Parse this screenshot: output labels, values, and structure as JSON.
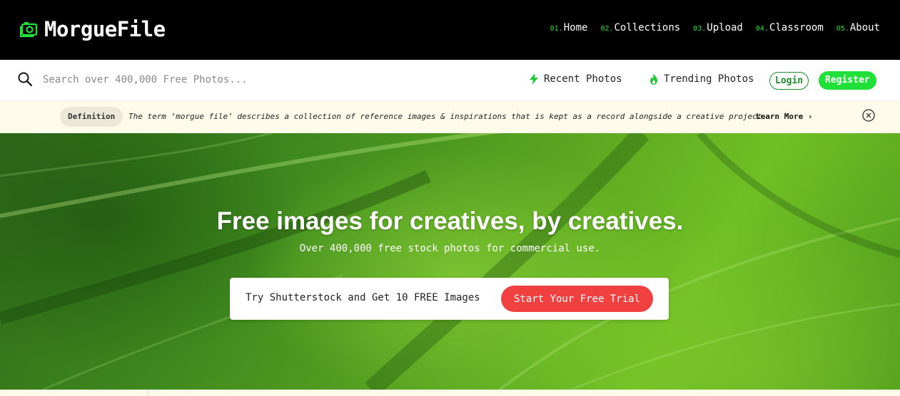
{
  "header": {
    "logo_text": "MorgueFile",
    "nav": [
      {
        "num": "01.",
        "label": "Home"
      },
      {
        "num": "02.",
        "label": "Collections"
      },
      {
        "num": "03.",
        "label": "Upload"
      },
      {
        "num": "04.",
        "label": "Classroom"
      },
      {
        "num": "05.",
        "label": "About"
      }
    ]
  },
  "search": {
    "placeholder": "Search over 400,000 Free Photos...",
    "value": "",
    "recent_label": "Recent Photos",
    "trending_label": "Trending Photos",
    "login_label": "Login",
    "register_label": "Register"
  },
  "definition": {
    "badge": "Definition",
    "text": "The term ‘morgue file’ describes a collection of reference images & inspirations that is kept as a record alongside a creative project.",
    "more_label": "Learn More ›"
  },
  "hero": {
    "title": "Free images for creatives, by creatives.",
    "subtitle": "Over 400,000 free stock photos for commercial use.",
    "promo_text": "Try Shutterstock and Get 10 FREE Images",
    "promo_button": "Start Your Free Trial"
  },
  "colors": {
    "accent_green": "#22e03a",
    "promo_red": "#f0403f",
    "banner_bg": "#fffbea"
  },
  "icons": {
    "logo": "camera-icon",
    "search": "search-icon",
    "recent": "lightning-icon",
    "trending": "flame-icon",
    "close": "close-circle-icon"
  }
}
